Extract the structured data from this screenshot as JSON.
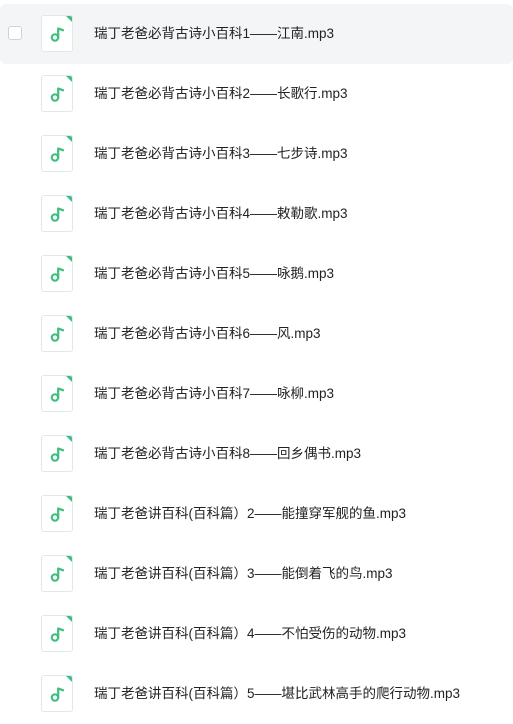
{
  "files": [
    {
      "name": "瑞丁老爸必背古诗小百科1——江南.mp3",
      "icon": "music-file-icon"
    },
    {
      "name": "瑞丁老爸必背古诗小百科2——长歌行.mp3",
      "icon": "music-file-icon"
    },
    {
      "name": "瑞丁老爸必背古诗小百科3——七步诗.mp3",
      "icon": "music-file-icon"
    },
    {
      "name": "瑞丁老爸必背古诗小百科4——敕勒歌.mp3",
      "icon": "music-file-icon"
    },
    {
      "name": "瑞丁老爸必背古诗小百科5——咏鹅.mp3",
      "icon": "music-file-icon"
    },
    {
      "name": "瑞丁老爸必背古诗小百科6——风.mp3",
      "icon": "music-file-icon"
    },
    {
      "name": "瑞丁老爸必背古诗小百科7——咏柳.mp3",
      "icon": "music-file-icon"
    },
    {
      "name": "瑞丁老爸必背古诗小百科8——回乡偶书.mp3",
      "icon": "music-file-icon"
    },
    {
      "name": "瑞丁老爸讲百科(百科篇）2——能撞穿军舰的鱼.mp3",
      "icon": "music-file-icon"
    },
    {
      "name": "瑞丁老爸讲百科(百科篇）3——能倒着飞的鸟.mp3",
      "icon": "music-file-icon"
    },
    {
      "name": "瑞丁老爸讲百科(百科篇）4——不怕受伤的动物.mp3",
      "icon": "music-file-icon"
    },
    {
      "name": "瑞丁老爸讲百科(百科篇）5——堪比武林高手的爬行动物.mp3",
      "icon": "music-file-icon"
    }
  ],
  "colors": {
    "accent_green": "#3fbf7f",
    "hover_background": "#f4f5f7",
    "text": "#222222"
  }
}
